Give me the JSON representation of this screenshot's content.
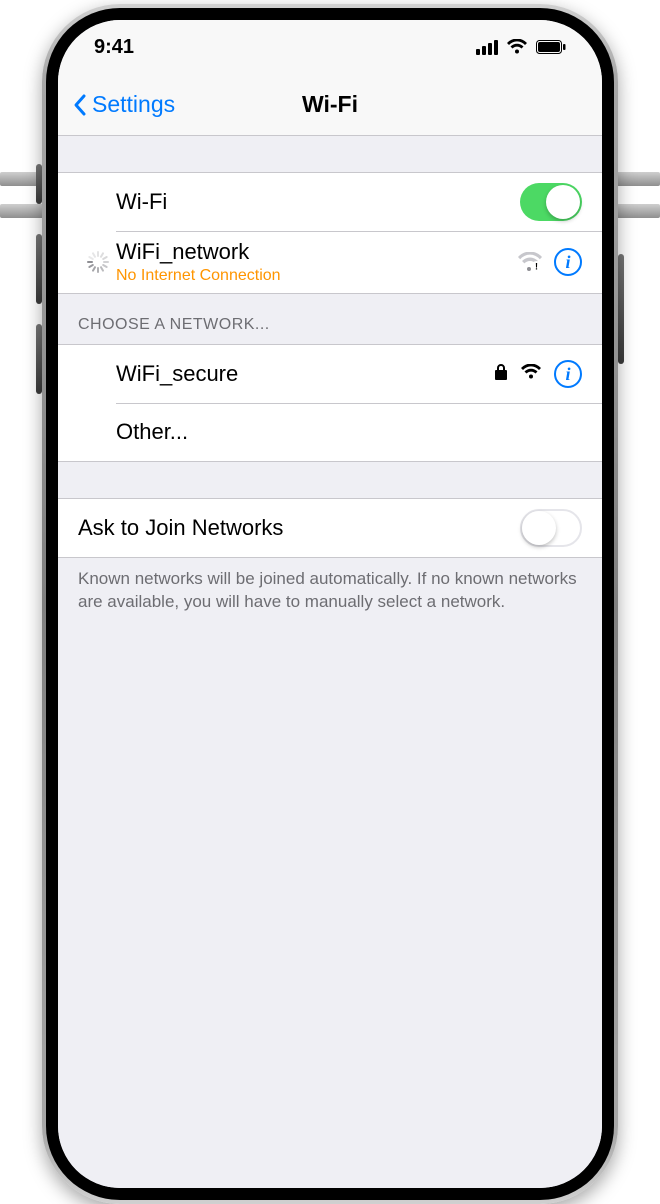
{
  "statusbar": {
    "time": "9:41"
  },
  "nav": {
    "back_label": "Settings",
    "title": "Wi-Fi"
  },
  "wifi_toggle": {
    "label": "Wi-Fi",
    "on": true
  },
  "current_network": {
    "name": "WiFi_network",
    "status": "No Internet Connection"
  },
  "choose_header": "Choose a Network...",
  "networks": [
    {
      "name": "WiFi_secure",
      "locked": true
    }
  ],
  "other_label": "Other...",
  "ask_join": {
    "label": "Ask to Join Networks",
    "on": false
  },
  "ask_join_footer": "Known networks will be joined automatically. If no known networks are available, you will have to manually select a network."
}
